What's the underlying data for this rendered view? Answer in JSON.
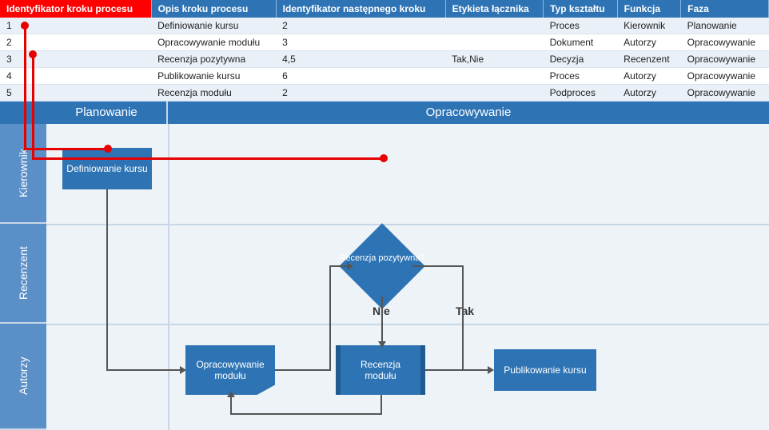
{
  "table": {
    "headers": {
      "id": "Identyfikator kroku procesu",
      "desc": "Opis kroku procesu",
      "next": "Identyfikator następnego kroku",
      "conn": "Etykieta łącznika",
      "shape": "Typ kształtu",
      "func": "Funkcja",
      "phase": "Faza"
    },
    "rows": [
      {
        "id": "1",
        "desc": "Definiowanie kursu",
        "next": "2",
        "conn": "",
        "shape": "Proces",
        "func": "Kierownik",
        "phase": "Planowanie"
      },
      {
        "id": "2",
        "desc": "Opracowywanie modułu",
        "next": "3",
        "conn": "",
        "shape": "Dokument",
        "func": "Autorzy",
        "phase": "Opracowywanie"
      },
      {
        "id": "3",
        "desc": "Recenzja pozytywna",
        "next": "4,5",
        "conn": "Tak,Nie",
        "shape": "Decyzja",
        "func": "Recenzent",
        "phase": "Opracowywanie"
      },
      {
        "id": "4",
        "desc": "Publikowanie kursu",
        "next": "6",
        "conn": "",
        "shape": "Proces",
        "func": "Autorzy",
        "phase": "Opracowywanie"
      },
      {
        "id": "5",
        "desc": "Recenzja modułu",
        "next": "2",
        "conn": "",
        "shape": "Podproces",
        "func": "Autorzy",
        "phase": "Opracowywanie"
      }
    ]
  },
  "diagram": {
    "phases": {
      "plan": "Planowanie",
      "dev": "Opracowywanie"
    },
    "lanes": {
      "kier": "Kierownik",
      "rec": "Recenzent",
      "aut": "Autorzy"
    },
    "shapes": {
      "def": "Definiowanie kursu",
      "opra": "Opracowywanie modułu",
      "dec": "Recenzja pozytywna?",
      "recm": "Recenzja modułu",
      "pub": "Publikowanie kursu"
    },
    "flow_labels": {
      "nie": "Nie",
      "tak": "Tak"
    }
  }
}
